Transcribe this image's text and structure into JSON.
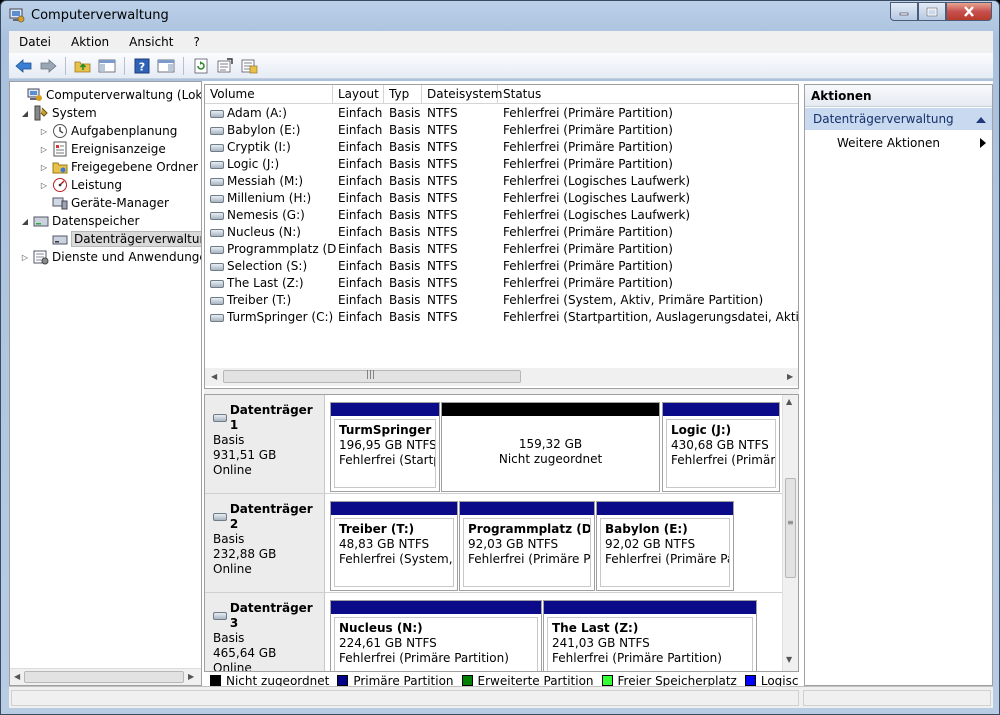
{
  "window": {
    "title": "Computerverwaltung"
  },
  "menu": [
    "Datei",
    "Aktion",
    "Ansicht",
    "?"
  ],
  "toolbar": {
    "buttons": [
      "back-icon",
      "forward-icon",
      "up-folder-icon",
      "show-hide-tree-icon",
      "help-icon",
      "show-hide-action-pane-icon",
      "refresh-icon",
      "properties-icon",
      "export-icon"
    ]
  },
  "tree": {
    "items": [
      {
        "label": "Computerverwaltung (Lokal)",
        "icon": "computer-management-icon",
        "level": 0,
        "expander": ""
      },
      {
        "label": "System",
        "icon": "system-tools-icon",
        "level": 1,
        "expander": "◢"
      },
      {
        "label": "Aufgabenplanung",
        "icon": "task-scheduler-icon",
        "level": 2,
        "expander": "▷"
      },
      {
        "label": "Ereignisanzeige",
        "icon": "event-viewer-icon",
        "level": 2,
        "expander": "▷"
      },
      {
        "label": "Freigegebene Ordner",
        "icon": "shared-folders-icon",
        "level": 2,
        "expander": "▷"
      },
      {
        "label": "Leistung",
        "icon": "performance-icon",
        "level": 2,
        "expander": "▷"
      },
      {
        "label": "Geräte-Manager",
        "icon": "device-manager-icon",
        "level": 2,
        "expander": ""
      },
      {
        "label": "Datenspeicher",
        "icon": "storage-icon",
        "level": 1,
        "expander": "◢"
      },
      {
        "label": "Datenträgerverwaltung",
        "icon": "disk-management-icon",
        "level": 2,
        "expander": ""
      },
      {
        "label": "Dienste und Anwendungen",
        "icon": "services-icon",
        "level": 1,
        "expander": "▷"
      }
    ]
  },
  "volumes": {
    "columns": [
      "Volume",
      "Layout",
      "Typ",
      "Dateisystem",
      "Status"
    ],
    "rows": [
      [
        "Adam (A:)",
        "Einfach",
        "Basis",
        "NTFS",
        "Fehlerfrei (Primäre Partition)"
      ],
      [
        "Babylon (E:)",
        "Einfach",
        "Basis",
        "NTFS",
        "Fehlerfrei (Primäre Partition)"
      ],
      [
        "Cryptik (I:)",
        "Einfach",
        "Basis",
        "NTFS",
        "Fehlerfrei (Primäre Partition)"
      ],
      [
        "Logic (J:)",
        "Einfach",
        "Basis",
        "NTFS",
        "Fehlerfrei (Primäre Partition)"
      ],
      [
        "Messiah (M:)",
        "Einfach",
        "Basis",
        "NTFS",
        "Fehlerfrei (Logisches Laufwerk)"
      ],
      [
        "Millenium (H:)",
        "Einfach",
        "Basis",
        "NTFS",
        "Fehlerfrei (Logisches Laufwerk)"
      ],
      [
        "Nemesis (G:)",
        "Einfach",
        "Basis",
        "NTFS",
        "Fehlerfrei (Logisches Laufwerk)"
      ],
      [
        "Nucleus (N:)",
        "Einfach",
        "Basis",
        "NTFS",
        "Fehlerfrei (Primäre Partition)"
      ],
      [
        "Programmplatz (D:)",
        "Einfach",
        "Basis",
        "NTFS",
        "Fehlerfrei (Primäre Partition)"
      ],
      [
        "Selection (S:)",
        "Einfach",
        "Basis",
        "NTFS",
        "Fehlerfrei (Primäre Partition)"
      ],
      [
        "The Last (Z:)",
        "Einfach",
        "Basis",
        "NTFS",
        "Fehlerfrei (Primäre Partition)"
      ],
      [
        "Treiber (T:)",
        "Einfach",
        "Basis",
        "NTFS",
        "Fehlerfrei (System, Aktiv, Primäre Partition)"
      ],
      [
        "TurmSpringer (C:)",
        "Einfach",
        "Basis",
        "NTFS",
        "Fehlerfrei (Startpartition, Auslagerungsdatei, Aktiv, Absturzabbild, Primäre Partition)"
      ]
    ]
  },
  "disks": [
    {
      "name": "Datenträger 1",
      "type": "Basis",
      "size": "931,51 GB",
      "state": "Online",
      "partitions": [
        {
          "name": "TurmSpringer  (C",
          "size": "196,95 GB NTFS",
          "status": "Fehlerfrei (Startpar",
          "kind": "primary"
        },
        {
          "name": "",
          "size": "159,32 GB",
          "status": "Nicht zugeordnet",
          "kind": "unallocated"
        },
        {
          "name": "Logic  (J:)",
          "size": "430,68 GB NTFS",
          "status": "Fehlerfrei (Primäre P",
          "kind": "primary"
        }
      ]
    },
    {
      "name": "Datenträger 2",
      "type": "Basis",
      "size": "232,88 GB",
      "state": "Online",
      "partitions": [
        {
          "name": "Treiber  (T:)",
          "size": "48,83 GB NTFS",
          "status": "Fehlerfrei (System, Ak",
          "kind": "primary"
        },
        {
          "name": "Programmplatz  (D:)",
          "size": "92,03 GB NTFS",
          "status": "Fehlerfrei (Primäre Part",
          "kind": "primary"
        },
        {
          "name": "Babylon  (E:)",
          "size": "92,02 GB NTFS",
          "status": "Fehlerfrei (Primäre Parti",
          "kind": "primary"
        }
      ]
    },
    {
      "name": "Datenträger 3",
      "type": "Basis",
      "size": "465,64 GB",
      "state": "Online",
      "partitions": [
        {
          "name": "Nucleus  (N:)",
          "size": "224,61 GB NTFS",
          "status": "Fehlerfrei (Primäre Partition)",
          "kind": "primary"
        },
        {
          "name": "The Last  (Z:)",
          "size": "241,03 GB NTFS",
          "status": "Fehlerfrei (Primäre Partition)",
          "kind": "primary"
        }
      ]
    }
  ],
  "legend": [
    {
      "label": "Nicht zugeordnet",
      "color": "#000000"
    },
    {
      "label": "Primäre Partition",
      "color": "#00008b"
    },
    {
      "label": "Erweiterte Partition",
      "color": "#008000"
    },
    {
      "label": "Freier Speicherplatz",
      "color": "#33ff33"
    },
    {
      "label": "Logisches Laufwerk",
      "color": "#0000ff"
    }
  ],
  "colors": {
    "primary": "#0b0b8a",
    "unallocated": "#000000"
  },
  "actions": {
    "header": "Aktionen",
    "section": "Datenträgerverwaltung",
    "items": [
      "Weitere Aktionen"
    ]
  }
}
